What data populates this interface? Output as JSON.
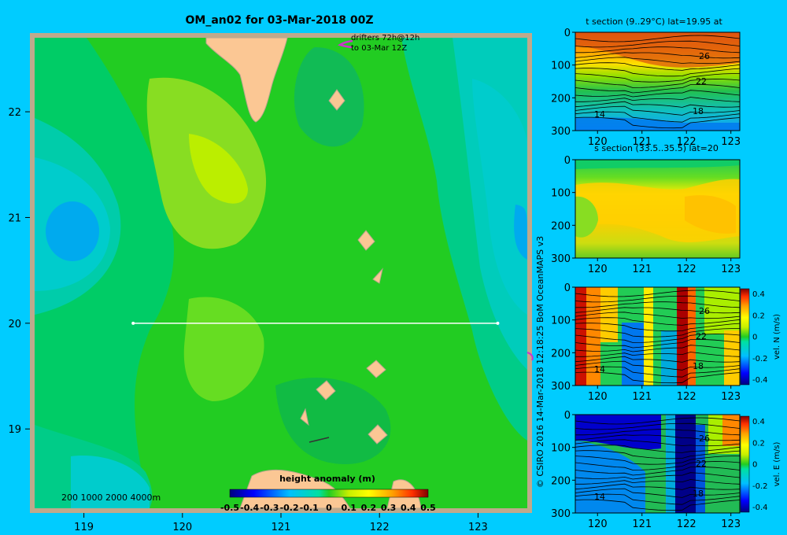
{
  "figure": {
    "title": "OM_an02 for 03-Mar-2018 00Z",
    "credit": "© CSIRO 2016   14-Mar-2018 12:18:25 BoM OceanMAPS v3",
    "colors": {
      "background": "#00ccff",
      "land": "#fbc794",
      "coast_border": "#b9a58c"
    }
  },
  "map": {
    "type": "heatmap",
    "xticks": [
      "119",
      "120",
      "121",
      "122",
      "123"
    ],
    "yticks": [
      "22",
      "21",
      "20",
      "19"
    ],
    "xlim": [
      118.5,
      123.5
    ],
    "ylim": [
      18.25,
      22.7
    ],
    "drifters_label_line1": "drifters 72h@12h",
    "drifters_label_line2": "to 03-Mar 12Z",
    "depth_legend": "200  1000  2000  4000m",
    "section_line": {
      "lat": 20,
      "lon_start": 119.5,
      "lon_end": 123.2
    },
    "colorbar": {
      "title": "height anomaly (m)",
      "ticks": [
        "-0.5",
        "-0.4",
        "-0.3",
        "-0.2",
        "-0.1",
        "0",
        "0.1",
        "0.2",
        "0.3",
        "0.4",
        "0.5"
      ],
      "range": [
        -0.5,
        0.5
      ]
    },
    "anomaly_features": [
      {
        "lon": 118.85,
        "lat": 20.85,
        "value": -0.16
      },
      {
        "lon": 123.3,
        "lat": 21.0,
        "value": -0.12
      },
      {
        "lon": 120.2,
        "lat": 21.3,
        "value": 0.12
      },
      {
        "lon": 120.5,
        "lat": 19.9,
        "value": 0.06
      },
      {
        "lon": 119.0,
        "lat": 18.5,
        "value": -0.08
      }
    ]
  },
  "panels": [
    {
      "id": "t",
      "title": "t section (9..29°C) lat=19.95 at",
      "xticks": [
        "120",
        "121",
        "122",
        "123"
      ],
      "yticks": [
        "0",
        "100",
        "200",
        "300"
      ],
      "contour_labels": [
        "26",
        "22",
        "18",
        "14"
      ],
      "colorbar": null
    },
    {
      "id": "s",
      "title": "s section (33.5..35.5) lat=20",
      "xticks": [
        "120",
        "121",
        "122",
        "123"
      ],
      "yticks": [
        "0",
        "100",
        "200",
        "300"
      ],
      "contour_labels": [],
      "colorbar": null
    },
    {
      "id": "vn",
      "title": "",
      "xticks": [
        "120",
        "121",
        "122",
        "123"
      ],
      "yticks": [
        "0",
        "100",
        "200",
        "300"
      ],
      "contour_labels": [
        "26",
        "22",
        "18",
        "14"
      ],
      "colorbar": {
        "label": "vel. N (m/s)",
        "ticks": [
          "0.4",
          "0.2",
          "0",
          "-0.2",
          "-0.4"
        ],
        "range": [
          -0.4,
          0.4
        ]
      }
    },
    {
      "id": "ve",
      "title": "",
      "xticks": [
        "120",
        "121",
        "122",
        "123"
      ],
      "yticks": [
        "0",
        "100",
        "200",
        "300"
      ],
      "contour_labels": [
        "26",
        "22",
        "18",
        "14"
      ],
      "colorbar": {
        "label": "vel. E (m/s)",
        "ticks": [
          "0.4",
          "0.2",
          "0",
          "-0.2",
          "-0.4"
        ],
        "range": [
          -0.4,
          0.4
        ]
      }
    }
  ],
  "chart_data": [
    {
      "type": "heatmap",
      "title": "OM_an02 for 03-Mar-2018 00Z",
      "xlabel": "",
      "ylabel": "",
      "xlim": [
        118.5,
        123.5
      ],
      "ylim": [
        18.25,
        22.7
      ],
      "colorbar_label": "height anomaly (m)",
      "color_range": [
        -0.5,
        0.5
      ]
    },
    {
      "type": "heatmap",
      "title": "t section (9..29°C) lat=19.95 at",
      "xlim": [
        119.5,
        123.2
      ],
      "ylim": [
        300,
        0
      ],
      "contour_labels": [
        26,
        22,
        18,
        14
      ]
    },
    {
      "type": "heatmap",
      "title": "s section (33.5..35.5) lat=20",
      "xlim": [
        119.5,
        123.2
      ],
      "ylim": [
        300,
        0
      ]
    },
    {
      "type": "heatmap",
      "title": "",
      "xlim": [
        119.5,
        123.2
      ],
      "ylim": [
        300,
        0
      ],
      "colorbar_label": "vel. N (m/s)",
      "color_range": [
        -0.4,
        0.4
      ]
    },
    {
      "type": "heatmap",
      "title": "",
      "xlim": [
        119.5,
        123.2
      ],
      "ylim": [
        300,
        0
      ],
      "colorbar_label": "vel. E (m/s)",
      "color_range": [
        -0.4,
        0.4
      ]
    }
  ]
}
